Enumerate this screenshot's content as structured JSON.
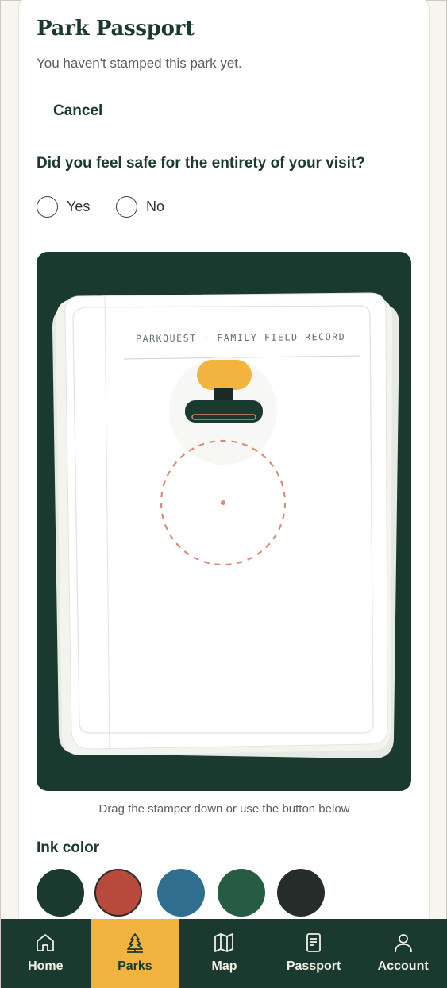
{
  "header": {
    "title": "Park Passport",
    "subtitle": "You haven't stamped this park yet."
  },
  "actions": {
    "cancel_label": "Cancel"
  },
  "safety": {
    "question": "Did you feel safe for the entirety of your visit?",
    "options": [
      {
        "label": "Yes",
        "selected": false
      },
      {
        "label": "No",
        "selected": false
      }
    ]
  },
  "passport_page": {
    "header_text": "PARKQUEST · FAMILY FIELD RECORD",
    "stamper_color": "#f2b33f",
    "stamp_target_color": "#d98a72"
  },
  "helper_text": "Drag the stamper down or use the button below",
  "ink": {
    "title": "Ink color",
    "colors": [
      {
        "name": "forest",
        "hex": "#1b3a2f",
        "selected": false
      },
      {
        "name": "rust",
        "hex": "#b84a3c",
        "selected": true
      },
      {
        "name": "blue",
        "hex": "#2f6e8f",
        "selected": false
      },
      {
        "name": "green",
        "hex": "#255c43",
        "selected": false
      },
      {
        "name": "charcoal",
        "hex": "#262c2a",
        "selected": false
      }
    ]
  },
  "nav": {
    "items": [
      {
        "label": "Home",
        "icon": "home-icon",
        "active": false
      },
      {
        "label": "Parks",
        "icon": "tree-icon",
        "active": true
      },
      {
        "label": "Map",
        "icon": "map-icon",
        "active": false
      },
      {
        "label": "Passport",
        "icon": "passport-icon",
        "active": false
      },
      {
        "label": "Account",
        "icon": "account-icon",
        "active": false
      }
    ]
  },
  "colors": {
    "primary": "#1b3a2f",
    "accent": "#f2b33f",
    "background": "#f6f5ef"
  }
}
